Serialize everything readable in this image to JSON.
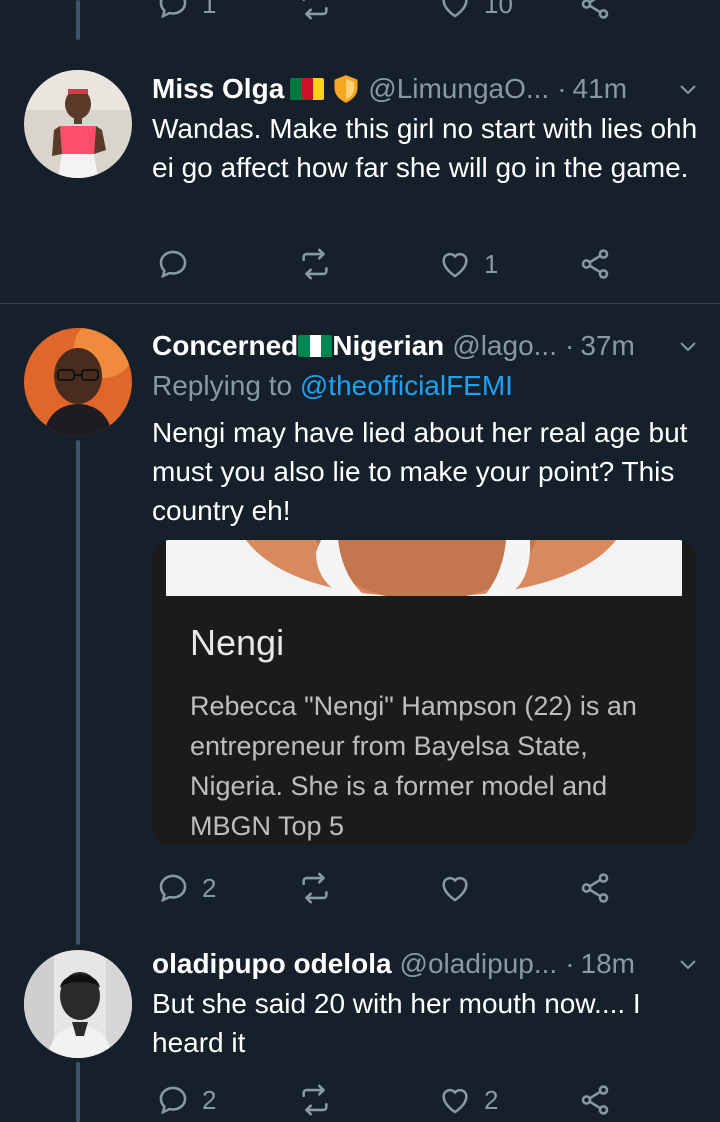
{
  "colors": {
    "background": "#15202b",
    "text_primary": "#ffffff",
    "text_secondary": "#8899a6",
    "mention": "#1da1f2",
    "divider": "#38444d",
    "thread_line": "#3d5466"
  },
  "top_action_bar": {
    "reply_count": "1",
    "retweet_count": "",
    "like_count": "10"
  },
  "tweets": [
    {
      "display_name": "Miss Olga",
      "flag": "cameroon-flag",
      "badge": "shield-emoji",
      "handle": "@LimungaO...",
      "separator": "·",
      "time": "41m",
      "text": "Wandas. Make this girl no start with lies ohh ei go affect how far she will go in the game.",
      "reply_count": "",
      "retweet_count": "",
      "like_count": "1"
    },
    {
      "display_name_part1": "Concerned",
      "flag": "nigeria-flag",
      "display_name_part2": "Nigerian",
      "handle": "@lago...",
      "separator": "·",
      "time": "37m",
      "replying_to_label": "Replying to",
      "replying_to_mention": "@theofficialFEMI",
      "text": "Nengi may have lied about her real age but must you also lie to make your point? This country eh!",
      "card": {
        "title": "Nengi",
        "text": "Rebecca \"Nengi\" Hampson (22) is an entrepreneur from Bayelsa State, Nigeria. She is a former model and MBGN Top 5"
      },
      "reply_count": "2",
      "retweet_count": "",
      "like_count": ""
    },
    {
      "display_name": "oladipupo odelola",
      "handle": "@oladipup...",
      "separator": "·",
      "time": "18m",
      "text": "But she said 20 with her mouth now.... I heard it",
      "reply_count": "2",
      "retweet_count": "",
      "like_count": "2"
    }
  ]
}
